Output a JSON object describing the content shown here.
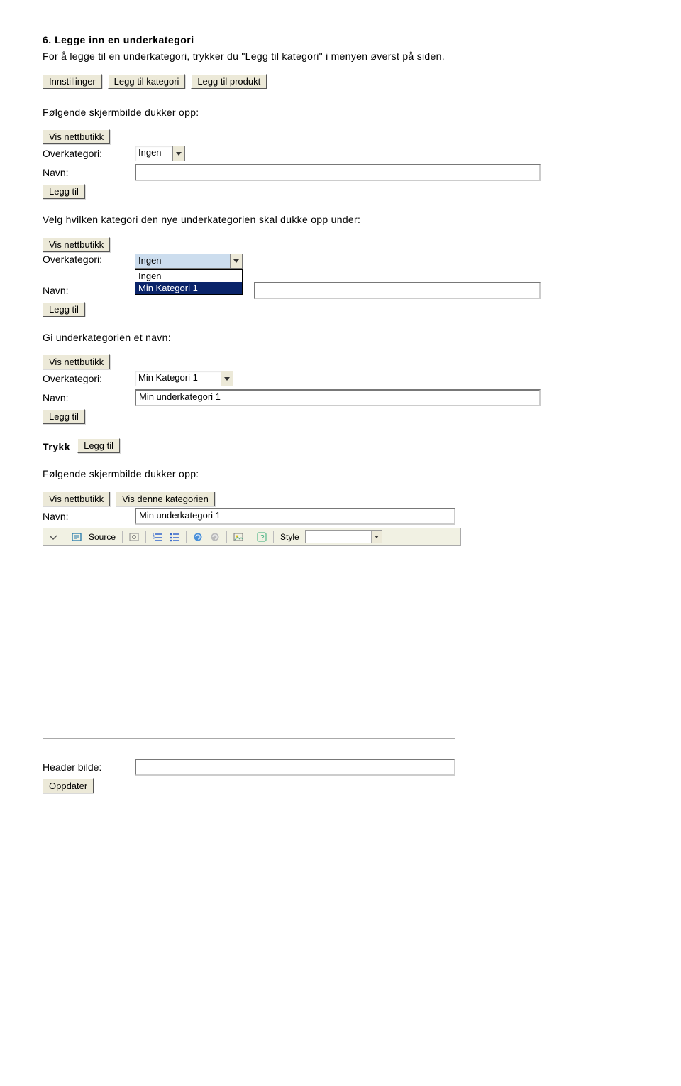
{
  "heading": "6. Legge inn en underkategori",
  "intro": "For å legge til en underkategori, trykker du \"Legg til kategori\" i menyen øverst på siden.",
  "top_buttons": {
    "a": "Innstillinger",
    "b": "Legg til kategori",
    "c": "Legg til produkt"
  },
  "txt_following1": "Følgende skjermbilde dukker opp:",
  "txt_pick": "Velg hvilken kategori den nye underkategorien skal dukke opp under:",
  "txt_givename": "Gi underkategorien et navn:",
  "txt_trykk": "Trykk",
  "txt_following2": "Følgende skjermbilde dukker opp:",
  "labels": {
    "vis": "Vis nettbutikk",
    "over": "Overkategori:",
    "navn": "Navn:",
    "leggtil": "Legg til",
    "viskat": "Vis denne kategorien",
    "header": "Header bilde:",
    "oppdater": "Oppdater"
  },
  "form1": {
    "over_value": "Ingen",
    "navn_value": ""
  },
  "form2": {
    "over_value": "Ingen",
    "navn_value": "",
    "dd_opt1": "Ingen",
    "dd_opt2": "Min Kategori 1"
  },
  "form3": {
    "over_value": "Min Kategori 1",
    "navn_value": "Min underkategori 1"
  },
  "result": {
    "navn_value": "Min underkategori 1",
    "header_value": ""
  },
  "toolbar": {
    "source": "Source",
    "style_label": "Style"
  }
}
